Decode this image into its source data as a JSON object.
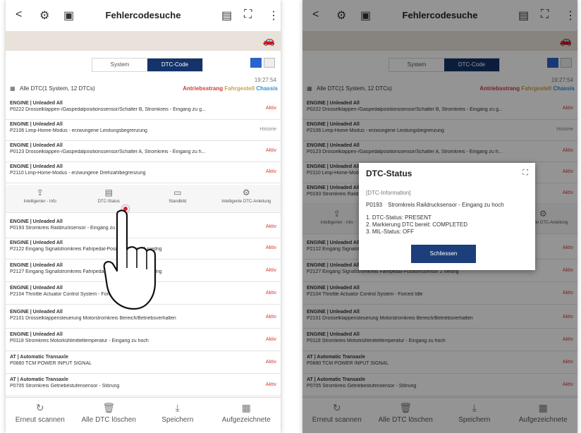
{
  "screen": {
    "nav": {
      "back": "<",
      "title": "Fehlercodesuche",
      "more": "⋮"
    },
    "tabs": [
      {
        "label": "System"
      },
      {
        "label": "DTC-Code",
        "active": true
      }
    ],
    "time": "19:27:54",
    "summary": "Alle DTC(1 System, 12 DTCs)",
    "categories": {
      "antrieb": "Antriebsstrang",
      "fahrgestell": "Fahrgestell",
      "chassis": "Chassis"
    },
    "dtcs": [
      {
        "system": "ENGINE | Unleaded All",
        "desc": "P0222 Drosselklappen-/Gaspedalpositionssensor/Schalter B, Stromkreis - Eingang zu g...",
        "status": "Aktiv"
      },
      {
        "system": "ENGINE | Unleaded All",
        "desc": "P2106 Limp-Home-Modus - erzwungene Leistungsbegrenzung",
        "status": "Historie"
      },
      {
        "system": "ENGINE | Unleaded All",
        "desc": "P0123 Drosselklappen-/Gaspedalpositionssensor/Schalter A, Stromkreis - Eingang zu h...",
        "status": "Aktiv"
      },
      {
        "system": "ENGINE | Unleaded All",
        "desc": "P2110 Limp-Home-Modus - erzwungene Drehzahlbegrenzung",
        "status": "Aktiv"
      },
      {
        "system": "ENGINE | Unleaded All",
        "desc": "P0193 Stromkreis Raildrucksensor - Eingang zu hoch",
        "status": "Aktiv"
      },
      {
        "system": "ENGINE | Unleaded All",
        "desc": "P2122 Eingang Signalstromkreis Fahrpedal-Positionssensor 1 niedrig",
        "status": "Aktiv"
      },
      {
        "system": "ENGINE | Unleaded All",
        "desc": "P2127 Eingang Signalstromkreis Fahrpedal-Positionssensor 2 niedrig",
        "status": "Aktiv"
      },
      {
        "system": "ENGINE | Unleaded All",
        "desc": "P2104 Throttle Actuator Control System - Forced Idle",
        "status": "Aktiv"
      },
      {
        "system": "ENGINE | Unleaded All",
        "desc": "P2101 Drosselklappensteuerung Motorstromkreis Bereich/Betriebsverhalten",
        "status": "Aktiv"
      },
      {
        "system": "ENGINE | Unleaded All",
        "desc": "P0118 Stromkreis Motorkühlmitteltemperatur - Eingang zu hoch",
        "status": "Aktiv"
      },
      {
        "system": "AT | Automatic Transaxle",
        "desc": "P0880 TCM POWER INPUT SIGNAL",
        "status": "Aktiv"
      },
      {
        "system": "AT | Automatic Transaxle",
        "desc": "P0705 Stromkreis Getriebestufensensor - Störung",
        "status": "Aktiv"
      }
    ],
    "actions": [
      {
        "label": "Intelligenter - Info",
        "icon": "share-icon"
      },
      {
        "label": "DTC-Status",
        "icon": "status-icon"
      },
      {
        "label": "Standbild",
        "icon": "freeze-frame-icon"
      },
      {
        "label": "Intelligente DTC-Anleitung",
        "icon": "gear-icon"
      }
    ],
    "bottom": [
      {
        "label": "Erneut scannen",
        "icon": "refresh-icon"
      },
      {
        "label": "Alle DTC löschen",
        "icon": "trash-icon"
      },
      {
        "label": "Speichern",
        "icon": "download-icon"
      },
      {
        "label": "Aufgezeichnete",
        "icon": "calendar-icon"
      }
    ]
  },
  "right_screen": {
    "actions": [
      {
        "label": "Intelligenter - Info"
      },
      {
        "label": "Intelligente DTC-Anleitung"
      }
    ],
    "bottom": [
      {
        "label": "Erneut scannen"
      },
      {
        "label": "Alle DTC löschen"
      },
      {
        "label": "Speichern"
      },
      {
        "label": "Aufgezeichnete"
      }
    ]
  },
  "dialog": {
    "title": "DTC-Status",
    "subtitle": "[DTC-Information]",
    "code": "P0193",
    "code_desc": "Stromkreis Raildrucksensor - Eingang zu hoch",
    "lines": [
      "1. DTC-Status: PRESENT",
      "2. Markierung DTC bereit: COMPLETED",
      "3. MIL-Status: OFF"
    ],
    "button": "Schliessen"
  },
  "colors": {
    "active_tab": "#13336a",
    "aktiv": "#d23a3a",
    "dialog_button": "#1c3e7a"
  }
}
